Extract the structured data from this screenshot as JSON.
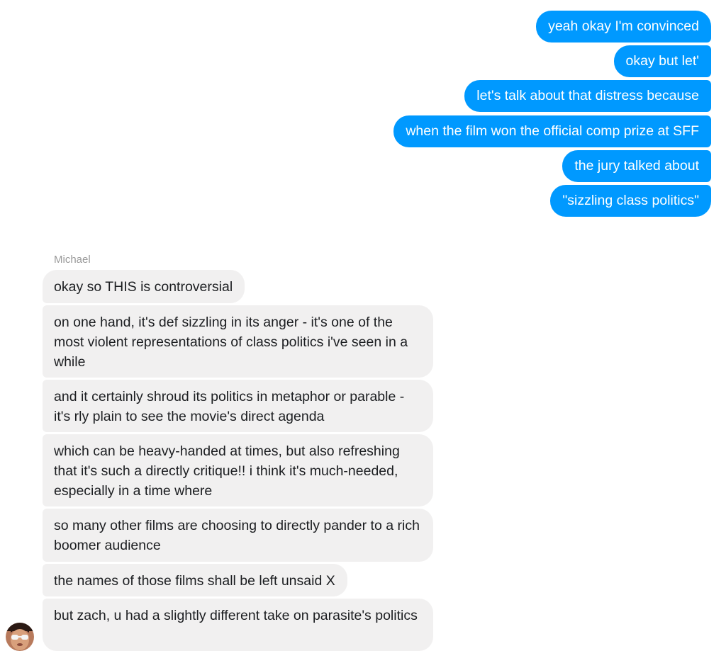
{
  "outgoing": [
    "yeah okay I'm convinced",
    "okay but let'",
    "let's talk about that distress because",
    "when the film won the official comp prize at SFF",
    "the jury talked about",
    "\"sizzling class politics\""
  ],
  "sender_name": "Michael",
  "incoming": [
    "okay so THIS is controversial",
    "on one hand, it's def sizzling in its anger - it's one of the most violent representations of class politics i've seen in a while",
    "and it certainly shroud its politics in metaphor or parable - it's rly plain to see the movie's direct agenda",
    "which can be heavy-handed at times, but also refreshing that it's such a directly critique!! i think it's much-needed, especially in a time where",
    "so many other films are choosing to directly pander to a rich boomer audience",
    "the names of those films shall be left unsaid X",
    "but zach, u had a slightly different take on parasite's politics"
  ],
  "colors": {
    "outgoing_bubble": "#0099ff",
    "incoming_bubble": "#f1f0f0"
  }
}
